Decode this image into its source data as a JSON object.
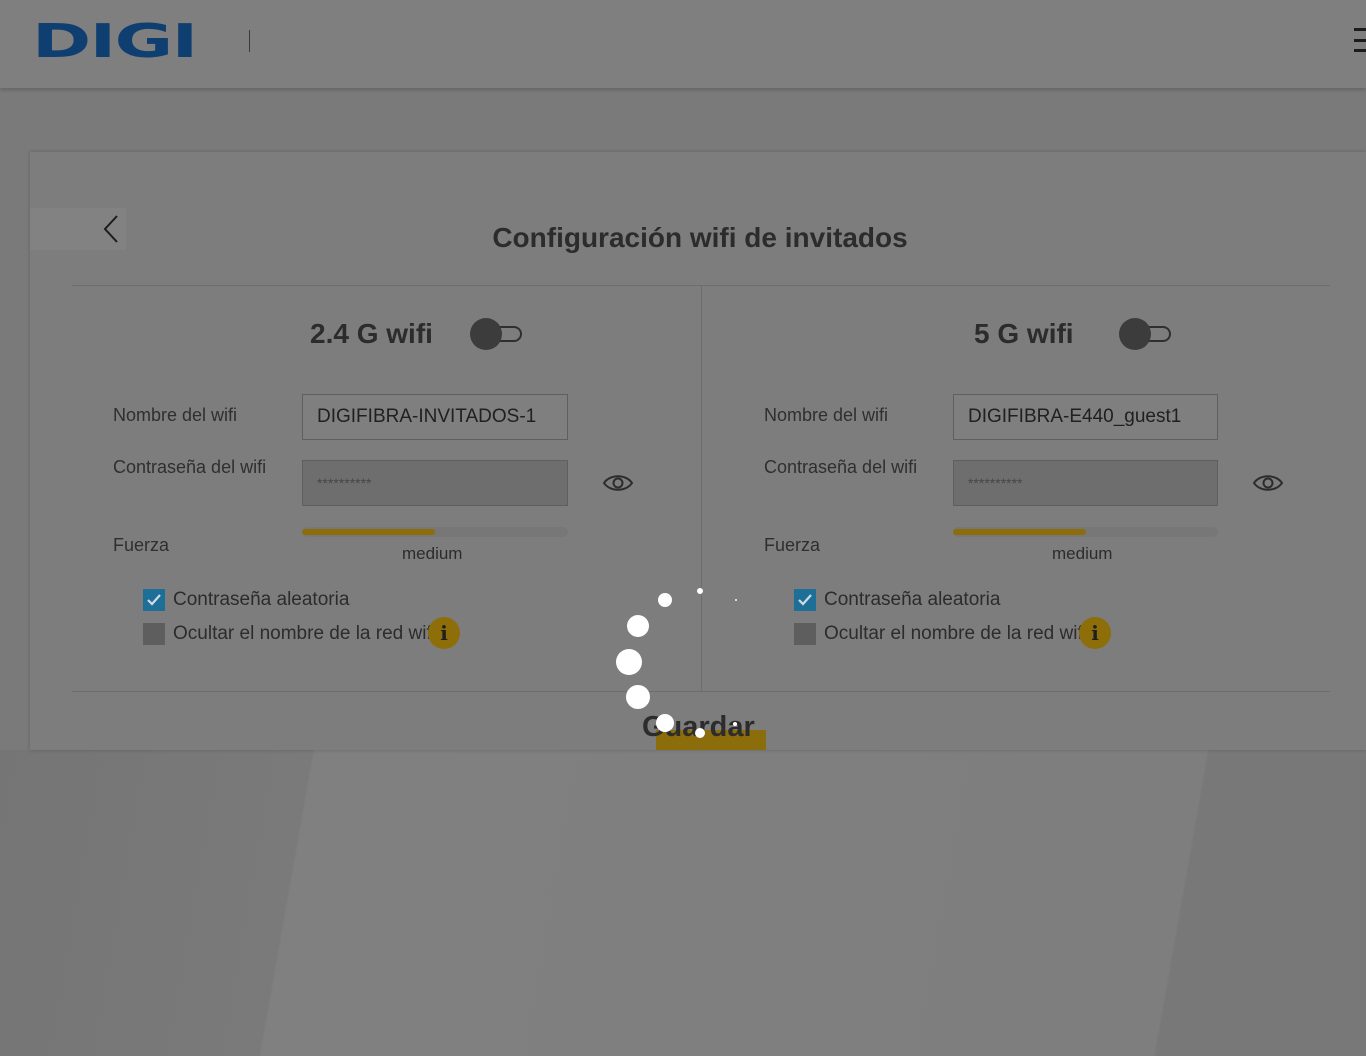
{
  "header": {
    "logo_text": "DIGI",
    "menu_icon": "hamburger-icon"
  },
  "page": {
    "title": "Configuración wifi de invitados",
    "back_icon": "chevron-left-icon",
    "save_label": "Guardar",
    "loading_icon": "loading-spinner-icon"
  },
  "bands": [
    {
      "title": "2.4 G wifi",
      "enabled": false,
      "ssid_label": "Nombre del wifi",
      "ssid_value": "DIGIFIBRA-INVITADOS-1",
      "password_label": "Contraseña del wifi",
      "password_value": "**********",
      "show_password_icon": "eye-icon",
      "strength_label": "Fuerza",
      "strength_value": "medium",
      "strength_fraction": 0.5,
      "random_password_label": "Contraseña aleatoria",
      "random_password_checked": true,
      "hide_ssid_label": "Ocultar el nombre de la red wifi",
      "hide_ssid_checked": false,
      "info_icon": "info-icon"
    },
    {
      "title": "5 G wifi",
      "enabled": false,
      "ssid_label": "Nombre del wifi",
      "ssid_value": "DIGIFIBRA-E440_guest1",
      "password_label": "Contraseña del wifi",
      "password_value": "**********",
      "show_password_icon": "eye-icon",
      "strength_label": "Fuerza",
      "strength_value": "medium",
      "strength_fraction": 0.5,
      "random_password_label": "Contraseña aleatoria",
      "random_password_checked": true,
      "hide_ssid_label": "Ocultar el nombre de la red wifi",
      "hide_ssid_checked": false,
      "info_icon": "info-icon"
    }
  ],
  "colors": {
    "brand": "#0f3f70",
    "accent": "#8c6d0c",
    "checkbox_checked": "#1e6f98",
    "overlay": "#7a7a7a"
  }
}
